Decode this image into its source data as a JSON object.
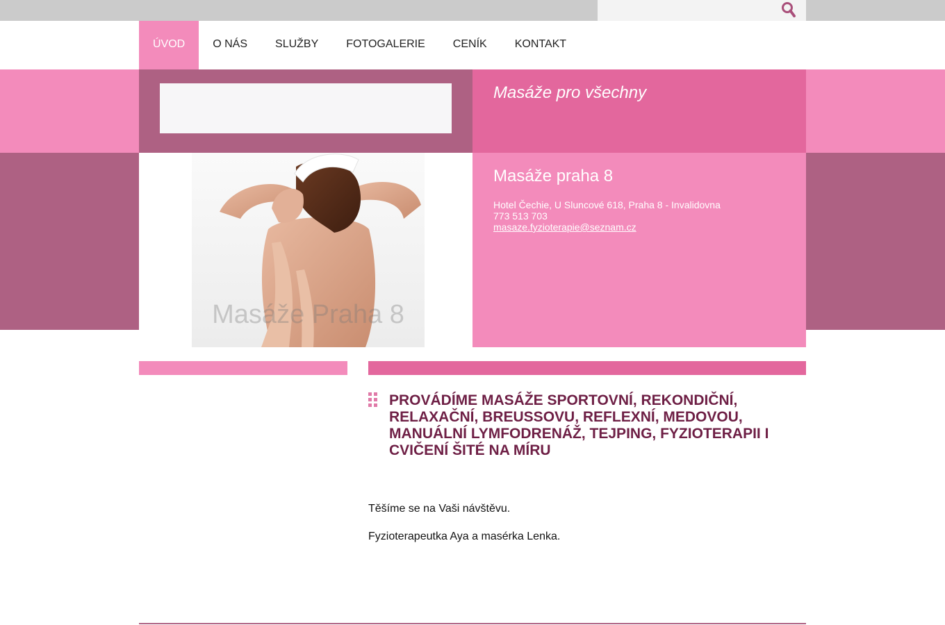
{
  "search": {
    "placeholder": "",
    "value": ""
  },
  "nav": {
    "items": [
      {
        "label": "ÚVOD",
        "active": true
      },
      {
        "label": "O NÁS",
        "active": false
      },
      {
        "label": "SLUŽBY",
        "active": false
      },
      {
        "label": "FOTOGALERIE",
        "active": false
      },
      {
        "label": "CENÍK",
        "active": false
      },
      {
        "label": "KONTAKT",
        "active": false
      }
    ]
  },
  "header": {
    "slogan": "Masáže pro všechny"
  },
  "contact": {
    "title": "Masáže praha 8",
    "address": "Hotel Čechie, U Sluncové 618, Praha 8 - Invalidovna",
    "phone": "773 513 703",
    "email": "masaze.fyzioterapie@seznam.cz"
  },
  "photo": {
    "watermark": "Masáže Praha 8"
  },
  "content": {
    "heading": "PROVÁDÍME MASÁŽE SPORTOVNÍ, REKONDIČNÍ, RELAXAČNÍ, BREUSSOVU, REFLEXNÍ, MEDOVOU, MANUÁLNÍ LYMFODRENÁŽ, TEJPING, FYZIOTERAPII I CVIČENÍ ŠITÉ NA MÍRU",
    "paragraph_1": "Těšíme se na Vaši návštěvu.",
    "paragraph_2": "Fyzioterapeutka Aya a masérka Lenka."
  },
  "colors": {
    "pink_light": "#f38bbb",
    "pink_mid": "#e3679d",
    "mauve": "#ae6183",
    "heading": "#6e1f45"
  },
  "icons": {
    "search": "search-icon",
    "heading_bullet": "dots-grid-icon"
  }
}
